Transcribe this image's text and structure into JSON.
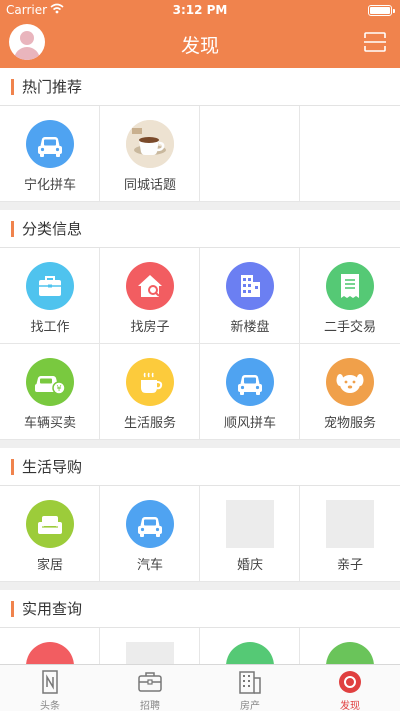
{
  "status": {
    "carrier": "Carrier",
    "time": "3:12 PM"
  },
  "header": {
    "title": "发现"
  },
  "sections": [
    {
      "title": "热门推荐",
      "items": [
        {
          "label": "宁化拼车",
          "icon": "car-icon",
          "color": "#4fa3f1"
        },
        {
          "label": "同城话题",
          "icon": "coffee-cup-photo",
          "color": "#d9c8b0"
        },
        {
          "label": "",
          "icon": ""
        },
        {
          "label": "",
          "icon": ""
        }
      ]
    },
    {
      "title": "分类信息",
      "items": [
        {
          "label": "找工作",
          "icon": "briefcase-icon",
          "color": "#4fc3ee"
        },
        {
          "label": "找房子",
          "icon": "house-search-icon",
          "color": "#f25d61"
        },
        {
          "label": "新楼盘",
          "icon": "building-icon",
          "color": "#6b7ff2"
        },
        {
          "label": "二手交易",
          "icon": "receipt-icon",
          "color": "#55c975"
        },
        {
          "label": "车辆买卖",
          "icon": "car-yen-icon",
          "color": "#79c93f"
        },
        {
          "label": "生活服务",
          "icon": "coffee-icon",
          "color": "#fccb3c"
        },
        {
          "label": "顺风拼车",
          "icon": "car-icon",
          "color": "#4fa3f1"
        },
        {
          "label": "宠物服务",
          "icon": "dog-icon",
          "color": "#f0a04a"
        }
      ]
    },
    {
      "title": "生活导购",
      "items": [
        {
          "label": "家居",
          "icon": "sofa-icon",
          "color": "#9ccc3a"
        },
        {
          "label": "汽车",
          "icon": "car-icon",
          "color": "#4fa3f1"
        },
        {
          "label": "婚庆",
          "icon": "placeholder"
        },
        {
          "label": "亲子",
          "icon": "placeholder"
        }
      ]
    },
    {
      "title": "实用查询",
      "items": [
        {
          "label": "",
          "icon": "partial-red-icon",
          "color": "#f25d61"
        },
        {
          "label": "",
          "icon": "placeholder"
        },
        {
          "label": "",
          "icon": "partial-green-icon",
          "color": "#55c975"
        },
        {
          "label": "",
          "icon": "partial-green-icon",
          "color": "#6ac45a"
        }
      ]
    }
  ],
  "tabbar": [
    {
      "label": "头条",
      "icon": "n-note-icon",
      "active": false
    },
    {
      "label": "招聘",
      "icon": "briefcase-outline-icon",
      "active": false
    },
    {
      "label": "房产",
      "icon": "building-outline-icon",
      "active": false
    },
    {
      "label": "发现",
      "icon": "discover-circle-icon",
      "active": true
    }
  ],
  "colors": {
    "accent": "#f0834d",
    "active_tab": "#e04040"
  }
}
